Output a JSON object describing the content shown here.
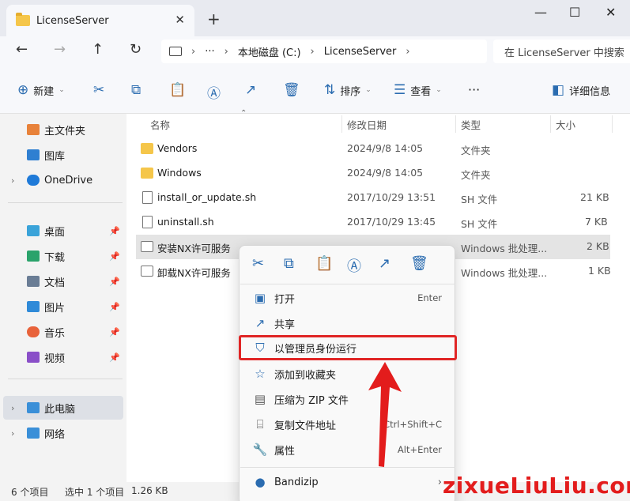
{
  "window": {
    "tab_title": "LicenseServer",
    "new_tab": "+",
    "minimize": "—",
    "maximize": "☐",
    "close": "✕"
  },
  "nav": {
    "address_more": "···",
    "path": [
      "本地磁盘 (C:)",
      "LicenseServer"
    ],
    "search_placeholder": "在 LicenseServer 中搜索"
  },
  "toolbar": {
    "new_label": "新建",
    "sort_label": "排序",
    "view_label": "查看",
    "more": "···",
    "details_label": "详细信息"
  },
  "sidebar": {
    "items": [
      {
        "label": "主文件夹"
      },
      {
        "label": "图库"
      },
      {
        "label": "OneDrive"
      },
      {
        "label": "桌面"
      },
      {
        "label": "下载"
      },
      {
        "label": "文档"
      },
      {
        "label": "图片"
      },
      {
        "label": "音乐"
      },
      {
        "label": "视频"
      },
      {
        "label": "此电脑"
      },
      {
        "label": "网络"
      }
    ]
  },
  "columns": {
    "name": "名称",
    "modified": "修改日期",
    "type": "类型",
    "size": "大小"
  },
  "files": [
    {
      "name": "Vendors",
      "modified": "2024/9/8 14:05",
      "type": "文件夹",
      "size": ""
    },
    {
      "name": "Windows",
      "modified": "2024/9/8 14:05",
      "type": "文件夹",
      "size": ""
    },
    {
      "name": "install_or_update.sh",
      "modified": "2017/10/29 13:51",
      "type": "SH 文件",
      "size": "21 KB"
    },
    {
      "name": "uninstall.sh",
      "modified": "2017/10/29 13:45",
      "type": "SH 文件",
      "size": "7 KB"
    },
    {
      "name": "安装NX许可服务",
      "modified": "",
      "type": "Windows 批处理...",
      "size": "2 KB"
    },
    {
      "name": "卸载NX许可服务",
      "modified": "",
      "type": "Windows 批处理...",
      "size": "1 KB"
    }
  ],
  "context_menu": {
    "items": [
      {
        "label": "打开",
        "shortcut": "Enter"
      },
      {
        "label": "共享",
        "shortcut": ""
      },
      {
        "label": "以管理员身份运行",
        "shortcut": ""
      },
      {
        "label": "添加到收藏夹",
        "shortcut": ""
      },
      {
        "label": "压缩为 ZIP 文件",
        "shortcut": ""
      },
      {
        "label": "复制文件地址",
        "shortcut": "Ctrl+Shift+C"
      },
      {
        "label": "属性",
        "shortcut": "Alt+Enter"
      },
      {
        "label": "Bandizip",
        "shortcut": ""
      }
    ]
  },
  "status": {
    "count": "6 个项目",
    "selected": "选中 1 个项目",
    "size": "1.26 KB"
  },
  "watermark": "zixueLiuLiu.com",
  "colors": {
    "highlight": "#e02525",
    "accent": "#2b6cb0",
    "folder": "#f5c64a"
  }
}
